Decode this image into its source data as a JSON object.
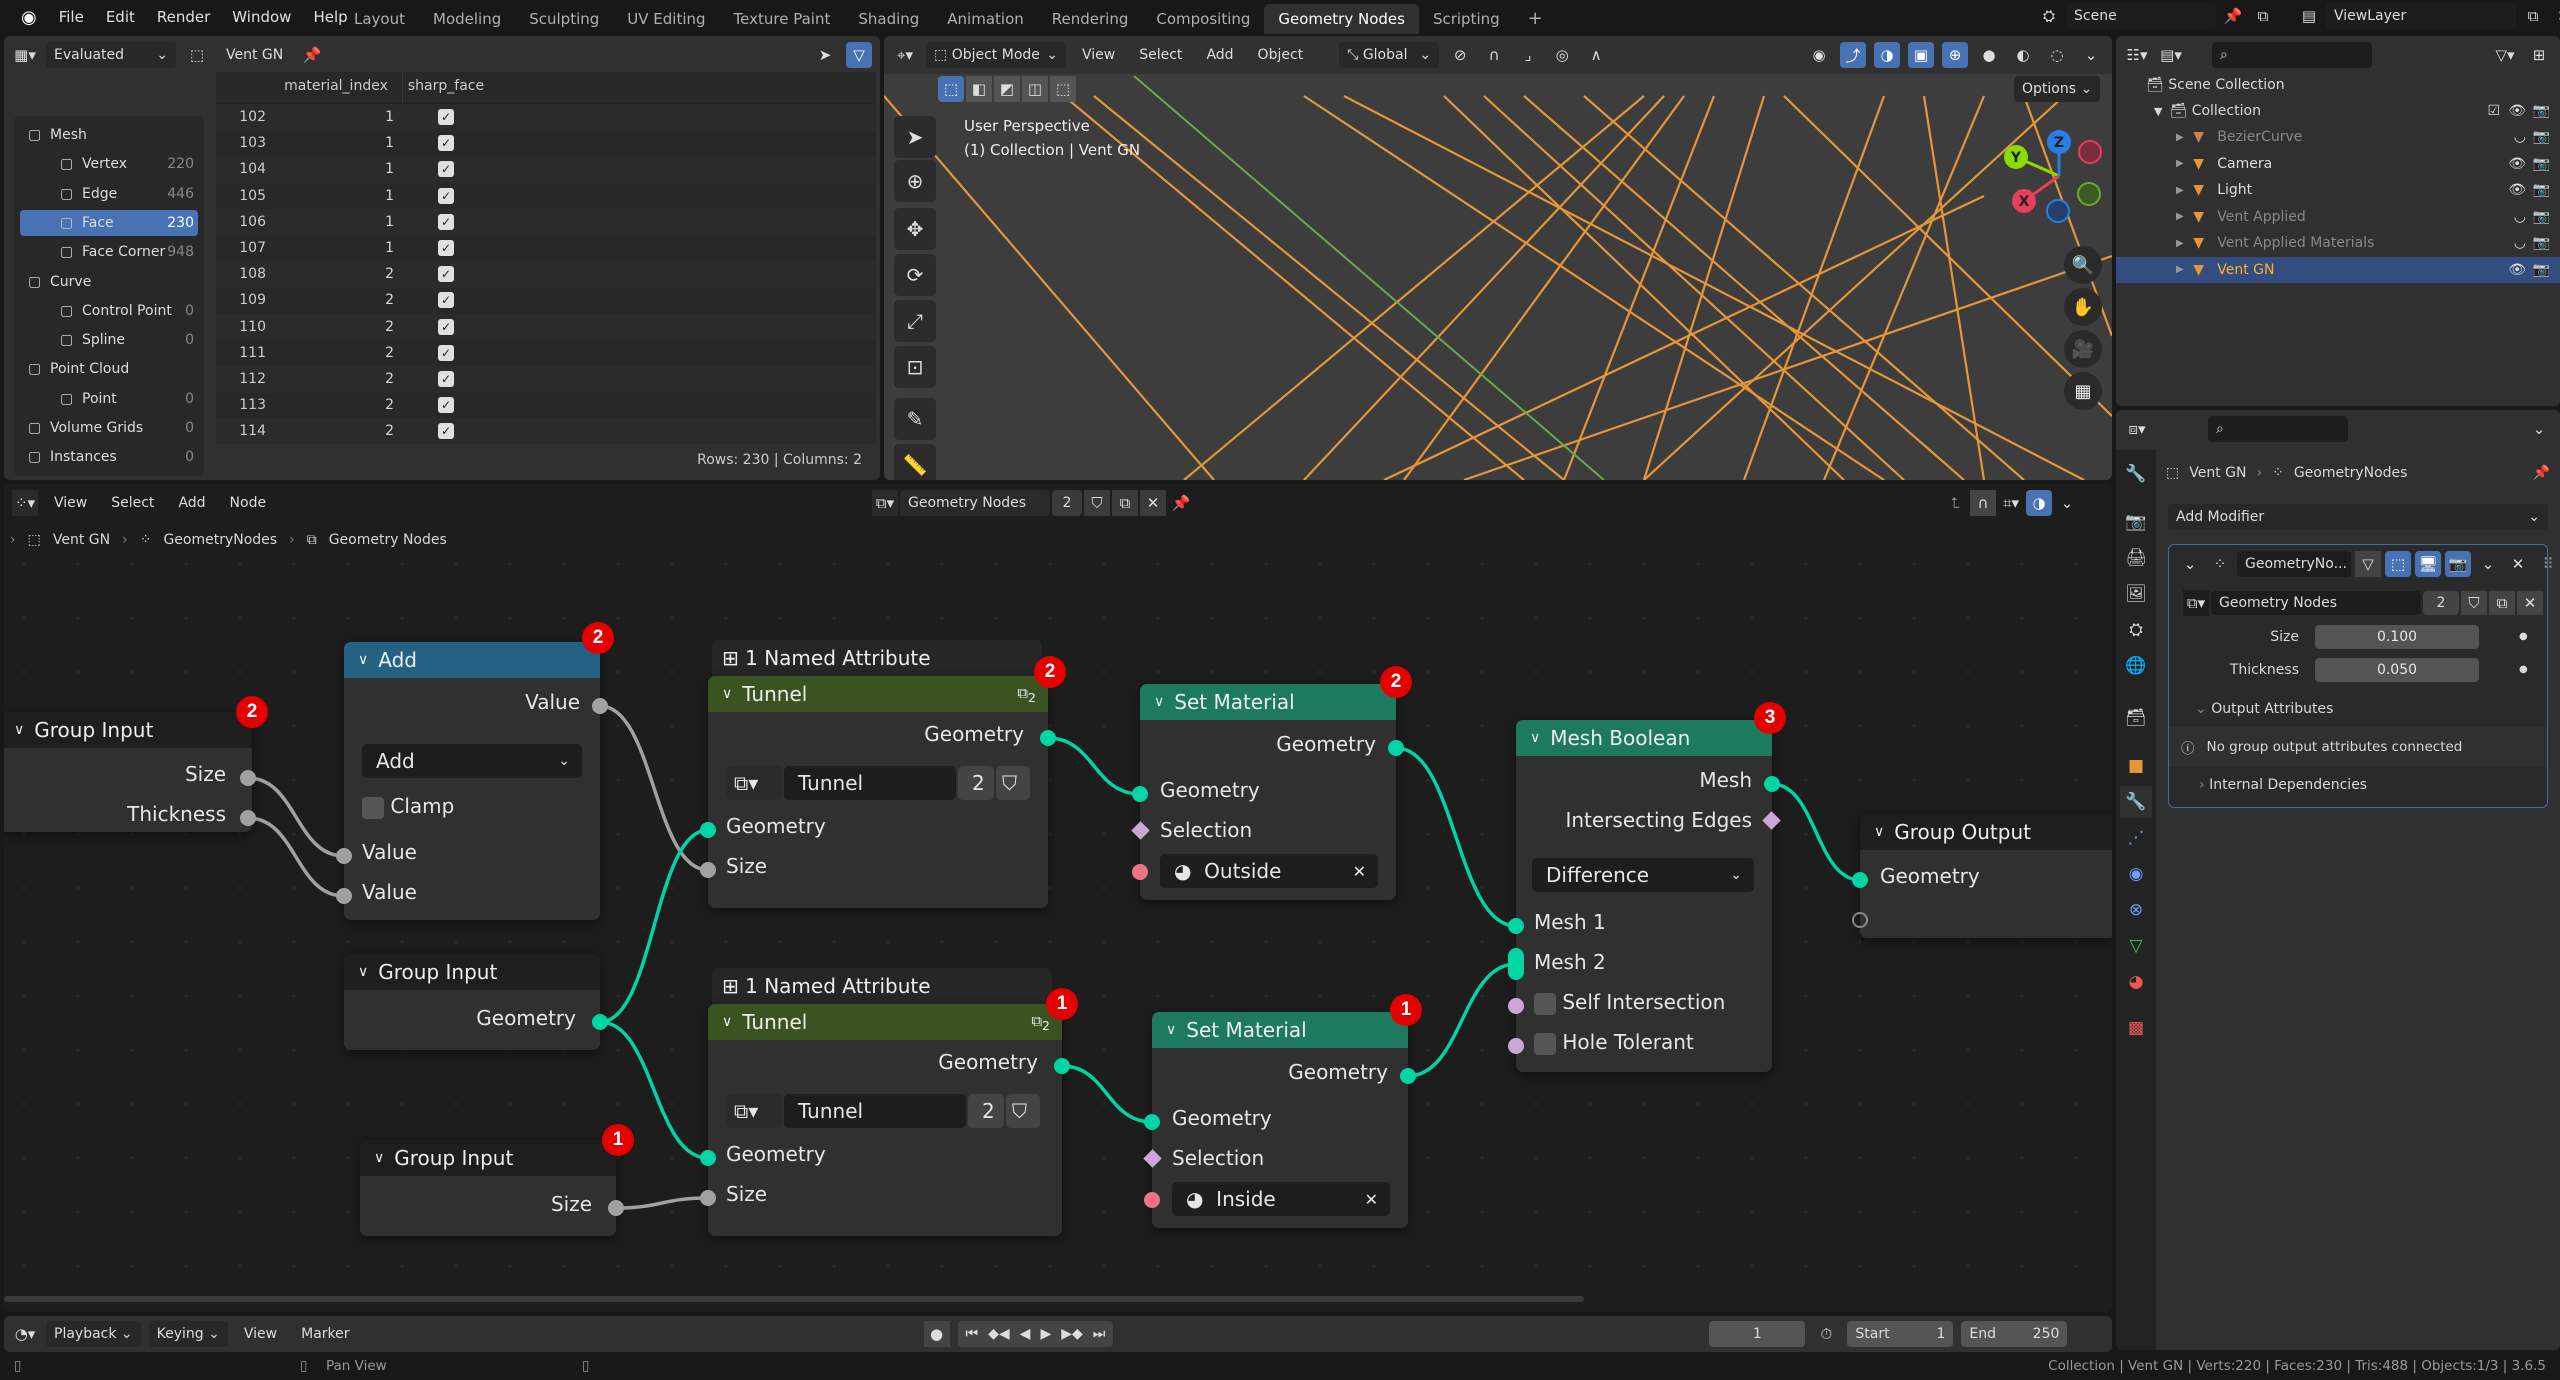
{
  "menubar": {
    "items": [
      "File",
      "Edit",
      "Render",
      "Window",
      "Help"
    ],
    "workspaces": [
      "Layout",
      "Modeling",
      "Sculpting",
      "UV Editing",
      "Texture Paint",
      "Shading",
      "Animation",
      "Rendering",
      "Compositing",
      "Geometry Nodes",
      "Scripting"
    ],
    "active_workspace": "Geometry Nodes",
    "scene": "Scene",
    "view_layer": "ViewLayer"
  },
  "spreadsheet": {
    "display_mode": "Evaluated",
    "object": "Vent GN",
    "domains": [
      {
        "label": "Mesh",
        "count": "",
        "level": 0,
        "icon": "mesh-icon"
      },
      {
        "label": "Vertex",
        "count": "220",
        "level": 1,
        "icon": "vertex-icon"
      },
      {
        "label": "Edge",
        "count": "446",
        "level": 1,
        "icon": "edge-icon"
      },
      {
        "label": "Face",
        "count": "230",
        "level": 1,
        "icon": "face-icon",
        "selected": true
      },
      {
        "label": "Face Corner",
        "count": "948",
        "level": 1,
        "icon": "face-corner-icon"
      },
      {
        "label": "Curve",
        "count": "",
        "level": 0,
        "icon": "curve-icon"
      },
      {
        "label": "Control Point",
        "count": "0",
        "level": 1,
        "icon": "control-point-icon"
      },
      {
        "label": "Spline",
        "count": "0",
        "level": 1,
        "icon": "spline-icon"
      },
      {
        "label": "Point Cloud",
        "count": "",
        "level": 0,
        "icon": "point-cloud-icon"
      },
      {
        "label": "Point",
        "count": "0",
        "level": 1,
        "icon": "point-icon"
      },
      {
        "label": "Volume Grids",
        "count": "0",
        "level": 0,
        "icon": "volume-icon"
      },
      {
        "label": "Instances",
        "count": "0",
        "level": 0,
        "icon": "instances-icon"
      }
    ],
    "columns": [
      "material_index",
      "sharp_face"
    ],
    "rows": [
      {
        "idx": "102",
        "material_index": "1",
        "sharp_face": true
      },
      {
        "idx": "103",
        "material_index": "1",
        "sharp_face": true
      },
      {
        "idx": "104",
        "material_index": "1",
        "sharp_face": true
      },
      {
        "idx": "105",
        "material_index": "1",
        "sharp_face": true
      },
      {
        "idx": "106",
        "material_index": "1",
        "sharp_face": true
      },
      {
        "idx": "107",
        "material_index": "1",
        "sharp_face": true
      },
      {
        "idx": "108",
        "material_index": "2",
        "sharp_face": true
      },
      {
        "idx": "109",
        "material_index": "2",
        "sharp_face": true
      },
      {
        "idx": "110",
        "material_index": "2",
        "sharp_face": true
      },
      {
        "idx": "111",
        "material_index": "2",
        "sharp_face": true
      },
      {
        "idx": "112",
        "material_index": "2",
        "sharp_face": true
      },
      {
        "idx": "113",
        "material_index": "2",
        "sharp_face": true
      },
      {
        "idx": "114",
        "material_index": "2",
        "sharp_face": true
      }
    ],
    "footer": "Rows: 230   |   Columns: 2"
  },
  "viewport": {
    "mode": "Object Mode",
    "menus": [
      "View",
      "Select",
      "Add",
      "Object"
    ],
    "orientation": "Global",
    "options_label": "Options",
    "overlay_line1": "User Perspective",
    "overlay_line2": "(1) Collection | Vent GN",
    "gizmo_axes": [
      "X",
      "Y",
      "Z"
    ]
  },
  "outliner": {
    "root": "Scene Collection",
    "collection": "Collection",
    "items": [
      {
        "name": "BezierCurve",
        "dim": true,
        "icon": "curve-object-icon",
        "visible": false
      },
      {
        "name": "Camera",
        "dim": false,
        "icon": "camera-object-icon",
        "visible": true
      },
      {
        "name": "Light",
        "dim": false,
        "icon": "light-object-icon",
        "visible": true
      },
      {
        "name": "Vent Applied",
        "dim": true,
        "icon": "mesh-object-icon",
        "visible": false
      },
      {
        "name": "Vent Applied Materials",
        "dim": true,
        "icon": "mesh-object-icon",
        "visible": false
      },
      {
        "name": "Vent GN",
        "dim": false,
        "icon": "mesh-object-icon",
        "visible": true,
        "selected": true
      }
    ]
  },
  "properties": {
    "breadcrumb_object": "Vent GN",
    "breadcrumb_modifier": "GeometryNodes",
    "add_modifier": "Add Modifier",
    "modifier_name": "GeometryNo...",
    "node_group": "Geometry Nodes",
    "node_group_users": "2",
    "inputs": [
      {
        "label": "Size",
        "value": "0.100"
      },
      {
        "label": "Thickness",
        "value": "0.050"
      }
    ],
    "output_attributes": "Output Attributes",
    "output_info": "No group output attributes connected",
    "internal_dependencies": "Internal Dependencies"
  },
  "node_editor": {
    "menus": [
      "View",
      "Select",
      "Add",
      "Node"
    ],
    "node_group": "Geometry Nodes",
    "users": "2",
    "breadcrumb": [
      "Vent GN",
      "GeometryNodes",
      "Geometry Nodes"
    ],
    "nodes": {
      "group_input_a": {
        "title": "Group Input",
        "outputs": [
          "Size",
          "Thickness"
        ],
        "badge": "2"
      },
      "add": {
        "title": "Add",
        "output": "Value",
        "operation": "Add",
        "clamp": "Clamp",
        "inputs": [
          "Value",
          "Value"
        ],
        "badge": "2"
      },
      "group_input_b": {
        "title": "Group Input",
        "output": "Geometry"
      },
      "group_input_c": {
        "title": "Group Input",
        "output": "Size",
        "badge": "1"
      },
      "frame_top": {
        "title": "1 Named Attribute"
      },
      "tunnel_top": {
        "title": "Tunnel",
        "output": "Geometry",
        "group": "Tunnel",
        "users": "2",
        "inputs": [
          "Geometry",
          "Size"
        ],
        "badge": "2",
        "subscript": "2"
      },
      "frame_bottom": {
        "title": "1 Named Attribute"
      },
      "tunnel_bottom": {
        "title": "Tunnel",
        "output": "Geometry",
        "group": "Tunnel",
        "users": "2",
        "inputs": [
          "Geometry",
          "Size"
        ],
        "badge": "1",
        "subscript": "2"
      },
      "set_mat_top": {
        "title": "Set Material",
        "output": "Geometry",
        "inputs": [
          "Geometry",
          "Selection"
        ],
        "material": "Outside",
        "badge": "2"
      },
      "set_mat_bottom": {
        "title": "Set Material",
        "output": "Geometry",
        "inputs": [
          "Geometry",
          "Selection"
        ],
        "material": "Inside",
        "badge": "1"
      },
      "mesh_boolean": {
        "title": "Mesh Boolean",
        "outputs": [
          "Mesh",
          "Intersecting Edges"
        ],
        "operation": "Difference",
        "inputs": [
          "Mesh 1",
          "Mesh 2",
          "Self Intersection",
          "Hole Tolerant"
        ],
        "badge": "3"
      },
      "group_output": {
        "title": "Group Output",
        "inputs": [
          "Geometry"
        ]
      }
    }
  },
  "timeline": {
    "menus": [
      "Playback",
      "Keying",
      "View",
      "Marker"
    ],
    "current_frame": "1",
    "start_label": "Start",
    "start": "1",
    "end_label": "End",
    "end": "250"
  },
  "statusbar": {
    "hint": "Pan View",
    "info": "Collection | Vent GN | Verts:220 | Faces:230 | Tris:488 | Objects:1/3 | 3.6.5"
  },
  "colors": {
    "accent": "#4772b3",
    "geometry_socket": "#00d6a3",
    "float_socket": "#a1a1a1",
    "bool_socket": "#cca6d6",
    "material_socket": "#eb7582",
    "badge": "#e50000",
    "math_header": "#246283",
    "group_header": "#3b5320",
    "geo_header": "#1e7a5e",
    "wire": "#e59639"
  }
}
